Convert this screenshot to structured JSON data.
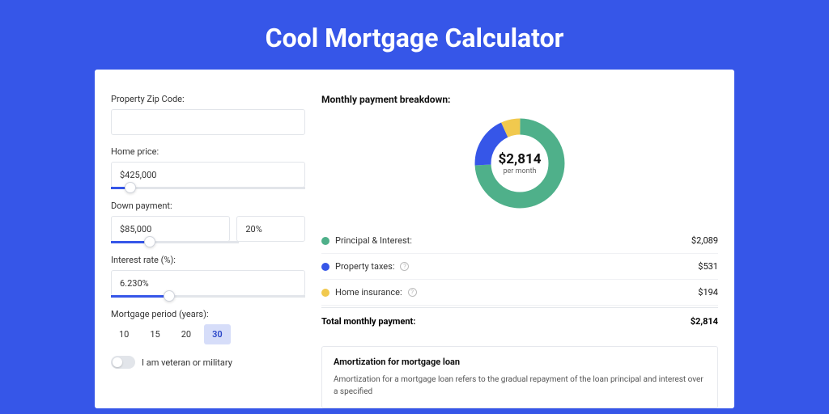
{
  "title": "Cool Mortgage Calculator",
  "form": {
    "zip_label": "Property Zip Code:",
    "zip_value": "",
    "price_label": "Home price:",
    "price_value": "$425,000",
    "price_slider_pct": 10,
    "down_label": "Down payment:",
    "down_value": "$85,000",
    "down_pct_value": "20%",
    "down_slider_pct": 20,
    "rate_label": "Interest rate (%):",
    "rate_value": "6.230%",
    "rate_slider_pct": 30,
    "period_label": "Mortgage period (years):",
    "periods": [
      "10",
      "15",
      "20",
      "30"
    ],
    "period_active": "30",
    "veteran_label": "I am veteran or military"
  },
  "breakdown": {
    "heading": "Monthly payment breakdown:",
    "center_amount": "$2,814",
    "center_sub": "per month",
    "items": [
      {
        "label": "Principal & Interest:",
        "value": "$2,089",
        "color": "#4fb08a",
        "has_info": false
      },
      {
        "label": "Property taxes:",
        "value": "$531",
        "color": "#3656e8",
        "has_info": true
      },
      {
        "label": "Home insurance:",
        "value": "$194",
        "color": "#f1c94e",
        "has_info": true
      }
    ],
    "total_label": "Total monthly payment:",
    "total_value": "$2,814"
  },
  "chart_data": {
    "type": "pie",
    "title": "Monthly payment breakdown",
    "categories": [
      "Principal & Interest",
      "Property taxes",
      "Home insurance"
    ],
    "values": [
      2089,
      531,
      194
    ],
    "colors": [
      "#4fb08a",
      "#3656e8",
      "#f1c94e"
    ],
    "total": 2814
  },
  "amortization": {
    "title": "Amortization for mortgage loan",
    "text": "Amortization for a mortgage loan refers to the gradual repayment of the loan principal and interest over a specified"
  }
}
